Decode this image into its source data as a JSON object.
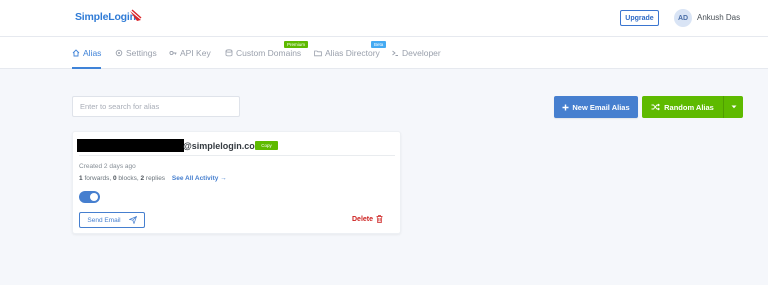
{
  "header": {
    "logo_text": "SimpleLogin",
    "upgrade_label": "Upgrade",
    "avatar_initials": "AD",
    "username": "Ankush Das"
  },
  "nav": {
    "items": [
      {
        "label": "Alias",
        "icon": "alias-icon",
        "active": true
      },
      {
        "label": "Settings",
        "icon": "gear-icon"
      },
      {
        "label": "API Key",
        "icon": "key-icon"
      },
      {
        "label": "Custom Domains",
        "icon": "database-icon",
        "tag": "Premium"
      },
      {
        "label": "Alias Directory",
        "icon": "folder-icon",
        "tag": "Beta"
      },
      {
        "label": "Developer",
        "icon": "terminal-icon"
      }
    ]
  },
  "toolbar": {
    "search_placeholder": "Enter to search for alias",
    "new_alias_label": "New Email Alias",
    "random_alias_label": "Random Alias"
  },
  "alias_card": {
    "email_domain": "@simplelogin.co",
    "copy_label": "Copy",
    "created": "Created 2 days ago",
    "forwards_count": "1",
    "forwards_text": "forwards,",
    "blocks_count": "0",
    "blocks_text": "blocks,",
    "replies_count": "2",
    "replies_text": "replies",
    "activity_link": "See All Activity →",
    "enabled": true,
    "send_email_label": "Send Email",
    "delete_label": "Delete"
  },
  "colors": {
    "brand_blue": "#467fcf",
    "green": "#5eba00",
    "danger": "#cd201f"
  }
}
